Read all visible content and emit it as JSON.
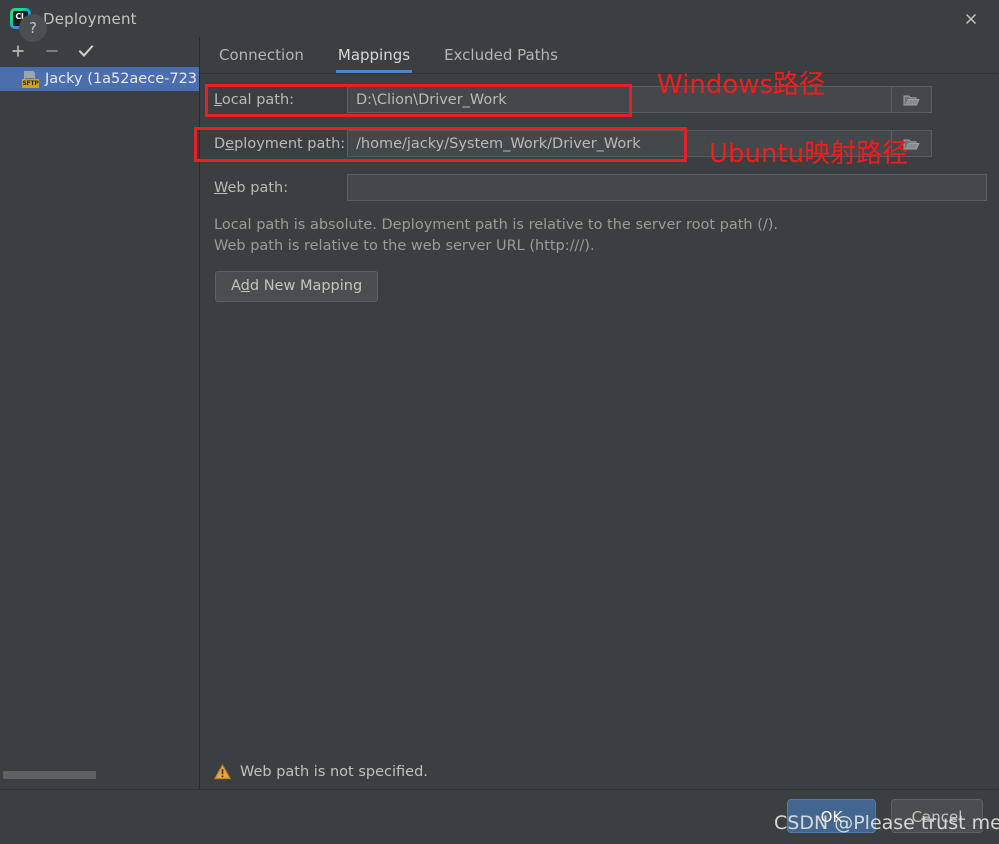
{
  "window": {
    "title": "Deployment",
    "logo_text": "CL",
    "close_icon": "close-icon"
  },
  "sidebar": {
    "toolbar": [
      {
        "name": "add-server-button",
        "icon": "plus-icon"
      },
      {
        "name": "remove-server-button",
        "icon": "minus-icon"
      },
      {
        "name": "set-default-server-button",
        "icon": "check-icon"
      }
    ],
    "servers": [
      {
        "label": "Jacky (1a52aece-723",
        "badge": "SFTP",
        "selected": true
      }
    ],
    "scrollbar": "horizontal-scrollbar"
  },
  "tabs": [
    {
      "label": "Connection",
      "active": false
    },
    {
      "label": "Mappings",
      "active": true
    },
    {
      "label": "Excluded Paths",
      "active": false
    }
  ],
  "form": {
    "local_path": {
      "label_pre": "L",
      "label_post": "ocal path:",
      "value": "D:\\Clion\\Driver_Work",
      "placeholder": "",
      "browse_icon": "folder-icon"
    },
    "deployment_path": {
      "label_pre": "D",
      "label_mid": "e",
      "label_post": "ployment path:",
      "value": "/home/jacky/System_Work/Driver_Work",
      "placeholder": "",
      "browse_icon": "folder-icon"
    },
    "web_path": {
      "label_pre": "W",
      "label_post": "eb path:",
      "value": "",
      "placeholder": ""
    },
    "help_line_1": "Local path is absolute. Deployment path is relative to the server root path (/).",
    "help_line_2": "Web path is relative to the web server URL (http:///).",
    "add_mapping": {
      "pre": "A",
      "accel": "d",
      "post": "d New Mapping"
    }
  },
  "warning": {
    "icon": "warning-triangle-icon",
    "text": "Web path is not specified."
  },
  "footer": {
    "help_label": "?",
    "ok_label": "OK",
    "cancel_label": "Cancel"
  },
  "annotations": {
    "box_local": "",
    "box_deployment": "",
    "note_windows": "Windows路径",
    "note_ubuntu": "Ubuntu映射路径"
  },
  "watermark": "CSDN @Please trust me",
  "colors": {
    "background": "#3c3f41",
    "selection_blue": "#4b6eaf",
    "tab_underline": "#4a88c7",
    "ok_button": "#42668f",
    "annotation_red": "#f41b1b",
    "warning_orange": "#e8a33d",
    "sftp_badge": "#c9a227"
  }
}
